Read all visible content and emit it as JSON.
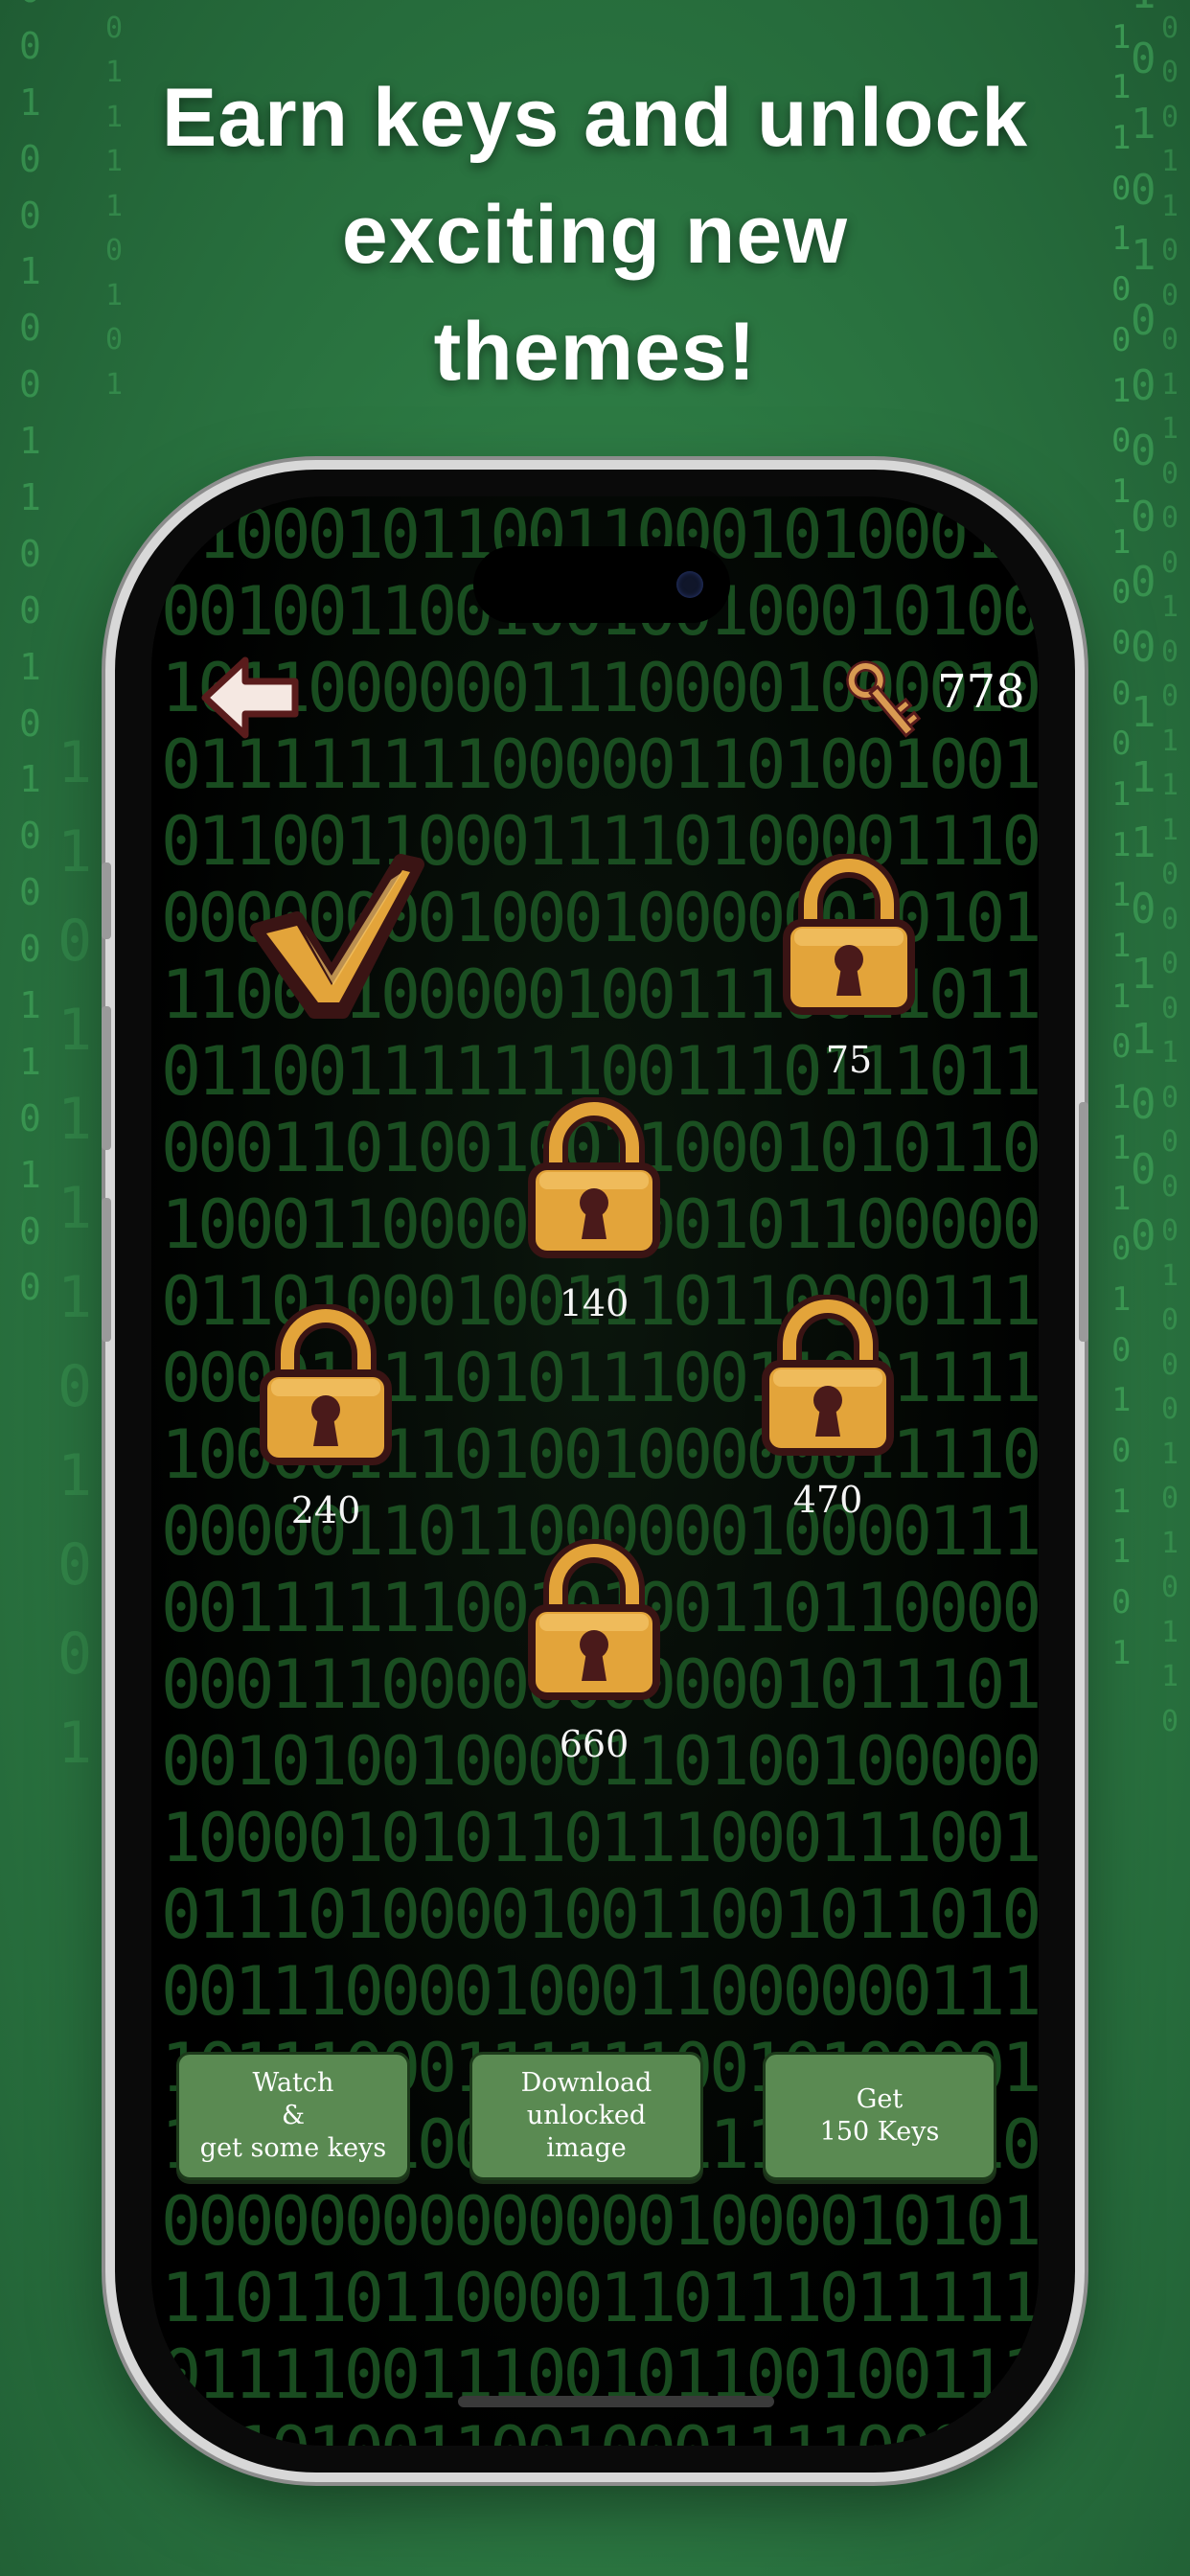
{
  "headline": {
    "line1": "Earn keys and unlock",
    "line2": "exciting new",
    "line3": "themes!"
  },
  "header": {
    "back_icon": "back-arrow-icon",
    "key_icon": "key-icon",
    "key_count": "778"
  },
  "themes": [
    {
      "status": "unlocked",
      "icon": "checkmark-icon"
    },
    {
      "status": "locked",
      "price": "75",
      "icon": "padlock-icon"
    },
    {
      "status": "locked",
      "price": "140",
      "icon": "padlock-icon"
    },
    {
      "status": "locked",
      "price": "240",
      "icon": "padlock-icon"
    },
    {
      "status": "locked",
      "price": "470",
      "icon": "padlock-icon"
    },
    {
      "status": "locked",
      "price": "660",
      "icon": "padlock-icon"
    }
  ],
  "actions": {
    "watch": "Watch\n&\nget some keys",
    "download": "Download\nunlocked\nimage",
    "buy": "Get\n150 Keys"
  },
  "colors": {
    "background_green": "#2e7d45",
    "matrix_green": "#1e5a26",
    "gold": "#e3a43a",
    "button_green": "#5a8a52"
  }
}
